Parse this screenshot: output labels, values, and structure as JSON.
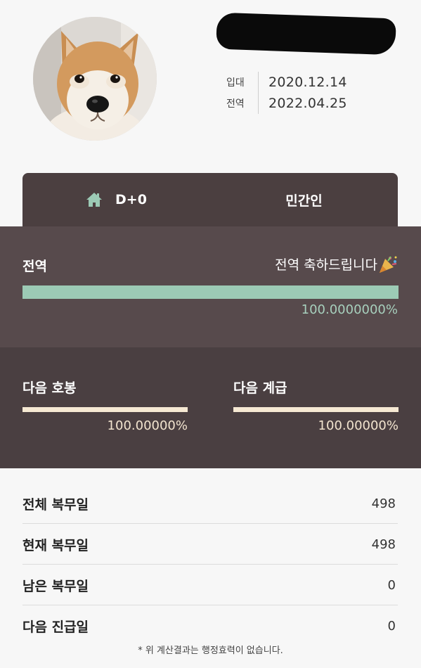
{
  "profile": {
    "avatar_alt": "shiba dog photo",
    "enlist_label": "입대",
    "enlist_date": "2020.12.14",
    "discharge_label": "전역",
    "discharge_date": "2022.04.25"
  },
  "tabs": [
    {
      "icon": "home-icon",
      "label": "D+0"
    },
    {
      "label": "민간인"
    }
  ],
  "discharge": {
    "title": "전역",
    "message": "전역 축하드립니다",
    "message_icon": "party-popper-icon",
    "progress": 1.0,
    "percent_text": "100.0000000%",
    "colors": {
      "fill": "#9ccab5",
      "text": "#a7d0bd"
    }
  },
  "promotions": [
    {
      "title": "다음 호봉",
      "progress": 1.0,
      "percent_text": "100.00000%"
    },
    {
      "title": "다음 계급",
      "progress": 1.0,
      "percent_text": "100.00000%"
    }
  ],
  "stats": [
    {
      "label": "전체 복무일",
      "value": "498"
    },
    {
      "label": "현재 복무일",
      "value": "498"
    },
    {
      "label": "남은 복무일",
      "value": "0"
    },
    {
      "label": "다음 진급일",
      "value": "0"
    }
  ],
  "footnote": "* 위 계산결과는 행정효력이 없습니다."
}
